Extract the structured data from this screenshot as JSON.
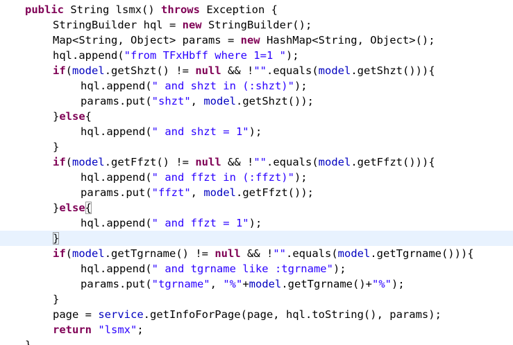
{
  "editor": {
    "colors": {
      "keyword": "#7f0055",
      "string": "#2a00ff",
      "field": "#0000c0",
      "plain": "#000000",
      "current_line": "#e8f2fe"
    },
    "lines": [
      [
        [
          "kw",
          "public"
        ],
        [
          "plain",
          " String lsmx() "
        ],
        [
          "kw",
          "throws"
        ],
        [
          "plain",
          " Exception {"
        ]
      ],
      [
        [
          "plain",
          "StringBuilder hql = "
        ],
        [
          "kw",
          "new"
        ],
        [
          "plain",
          " StringBuilder();"
        ]
      ],
      [
        [
          "plain",
          "Map<String, Object> params = "
        ],
        [
          "kw",
          "new"
        ],
        [
          "plain",
          " HashMap<String, Object>();"
        ]
      ],
      [
        [
          "plain",
          "hql.append("
        ],
        [
          "str",
          "\"from TFxHbff where 1=1 \""
        ],
        [
          "plain",
          ");"
        ]
      ],
      [
        [
          "kw",
          "if"
        ],
        [
          "plain",
          "("
        ],
        [
          "field",
          "model"
        ],
        [
          "plain",
          ".getShzt() != "
        ],
        [
          "kw",
          "null"
        ],
        [
          "plain",
          " && !"
        ],
        [
          "str",
          "\"\""
        ],
        [
          "plain",
          ".equals("
        ],
        [
          "field",
          "model"
        ],
        [
          "plain",
          ".getShzt())){"
        ]
      ],
      [
        [
          "plain",
          "hql.append("
        ],
        [
          "str",
          "\" and shzt in (:shzt)\""
        ],
        [
          "plain",
          ");"
        ]
      ],
      [
        [
          "plain",
          "params.put("
        ],
        [
          "str",
          "\"shzt\""
        ],
        [
          "plain",
          ", "
        ],
        [
          "field",
          "model"
        ],
        [
          "plain",
          ".getShzt());"
        ]
      ],
      [
        [
          "plain",
          "}"
        ],
        [
          "kw",
          "else"
        ],
        [
          "plain",
          "{"
        ]
      ],
      [
        [
          "plain",
          "hql.append("
        ],
        [
          "str",
          "\" and shzt = 1\""
        ],
        [
          "plain",
          ");"
        ]
      ],
      [
        [
          "plain",
          "}"
        ]
      ],
      [
        [
          "kw",
          "if"
        ],
        [
          "plain",
          "("
        ],
        [
          "field",
          "model"
        ],
        [
          "plain",
          ".getFfzt() != "
        ],
        [
          "kw",
          "null"
        ],
        [
          "plain",
          " && !"
        ],
        [
          "str",
          "\"\""
        ],
        [
          "plain",
          ".equals("
        ],
        [
          "field",
          "model"
        ],
        [
          "plain",
          ".getFfzt())){"
        ]
      ],
      [
        [
          "plain",
          "hql.append("
        ],
        [
          "str",
          "\" and ffzt in (:ffzt)\""
        ],
        [
          "plain",
          ");"
        ]
      ],
      [
        [
          "plain",
          "params.put("
        ],
        [
          "str",
          "\"ffzt\""
        ],
        [
          "plain",
          ", "
        ],
        [
          "field",
          "model"
        ],
        [
          "plain",
          ".getFfzt());"
        ]
      ],
      [
        [
          "plain",
          "}"
        ],
        [
          "kw",
          "else"
        ],
        [
          "box",
          "{"
        ]
      ],
      [
        [
          "plain",
          "hql.append("
        ],
        [
          "str",
          "\" and ffzt = 1\""
        ],
        [
          "plain",
          ");"
        ]
      ],
      [
        [
          "box",
          "}"
        ]
      ],
      [
        [
          "kw",
          "if"
        ],
        [
          "plain",
          "("
        ],
        [
          "field",
          "model"
        ],
        [
          "plain",
          ".getTgrname() != "
        ],
        [
          "kw",
          "null"
        ],
        [
          "plain",
          " && !"
        ],
        [
          "str",
          "\"\""
        ],
        [
          "plain",
          ".equals("
        ],
        [
          "field",
          "model"
        ],
        [
          "plain",
          ".getTgrname())){"
        ]
      ],
      [
        [
          "plain",
          "hql.append("
        ],
        [
          "str",
          "\" and tgrname like :tgrname\""
        ],
        [
          "plain",
          ");"
        ]
      ],
      [
        [
          "plain",
          "params.put("
        ],
        [
          "str",
          "\"tgrname\""
        ],
        [
          "plain",
          ", "
        ],
        [
          "str",
          "\"%\""
        ],
        [
          "plain",
          "+"
        ],
        [
          "field",
          "model"
        ],
        [
          "plain",
          ".getTgrname()+"
        ],
        [
          "str",
          "\"%\""
        ],
        [
          "plain",
          ");"
        ]
      ],
      [
        [
          "plain",
          "}"
        ]
      ],
      [
        [
          "plain",
          "page = "
        ],
        [
          "field",
          "service"
        ],
        [
          "plain",
          ".getInfoForPage(page, hql.toString(), params);"
        ]
      ],
      [
        [
          "kw",
          "return"
        ],
        [
          "plain",
          " "
        ],
        [
          "str",
          "\"lsmx\""
        ],
        [
          "plain",
          ";"
        ]
      ],
      [
        [
          "plain",
          "}"
        ]
      ]
    ]
  }
}
